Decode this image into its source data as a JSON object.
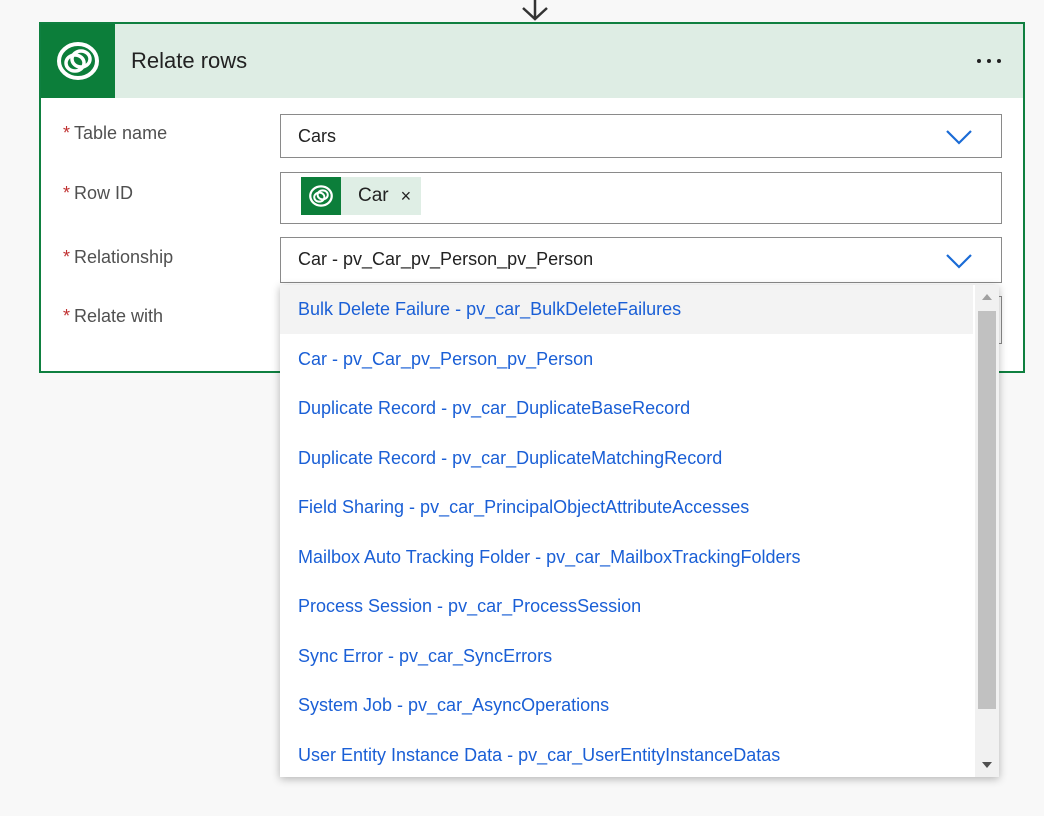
{
  "flow_arrow": {
    "icon": "arrow-down-icon"
  },
  "card": {
    "title": "Relate rows",
    "icon": "dataverse-icon",
    "more_icon": "more-options-icon",
    "accent": "#0c7e3a"
  },
  "fields": {
    "table_name": {
      "required_mark": "*",
      "label": "Table name",
      "value": "Cars"
    },
    "row_id": {
      "required_mark": "*",
      "label": "Row ID",
      "token": "Car",
      "remove_glyph": "×"
    },
    "relationship": {
      "required_mark": "*",
      "label": "Relationship",
      "value": "Car - pv_Car_pv_Person_pv_Person"
    },
    "relate_with": {
      "required_mark": "*",
      "label": "Relate with"
    }
  },
  "dropdown": {
    "options": [
      "Bulk Delete Failure - pv_car_BulkDeleteFailures",
      "Car - pv_Car_pv_Person_pv_Person",
      "Duplicate Record - pv_car_DuplicateBaseRecord",
      "Duplicate Record - pv_car_DuplicateMatchingRecord",
      "Field Sharing - pv_car_PrincipalObjectAttributeAccesses",
      "Mailbox Auto Tracking Folder - pv_car_MailboxTrackingFolders",
      "Process Session - pv_car_ProcessSession",
      "Sync Error - pv_car_SyncErrors",
      "System Job - pv_car_AsyncOperations",
      "User Entity Instance Data - pv_car_UserEntityInstanceDatas"
    ],
    "hovered_index": 0,
    "link_color": "#1a5fd6"
  }
}
